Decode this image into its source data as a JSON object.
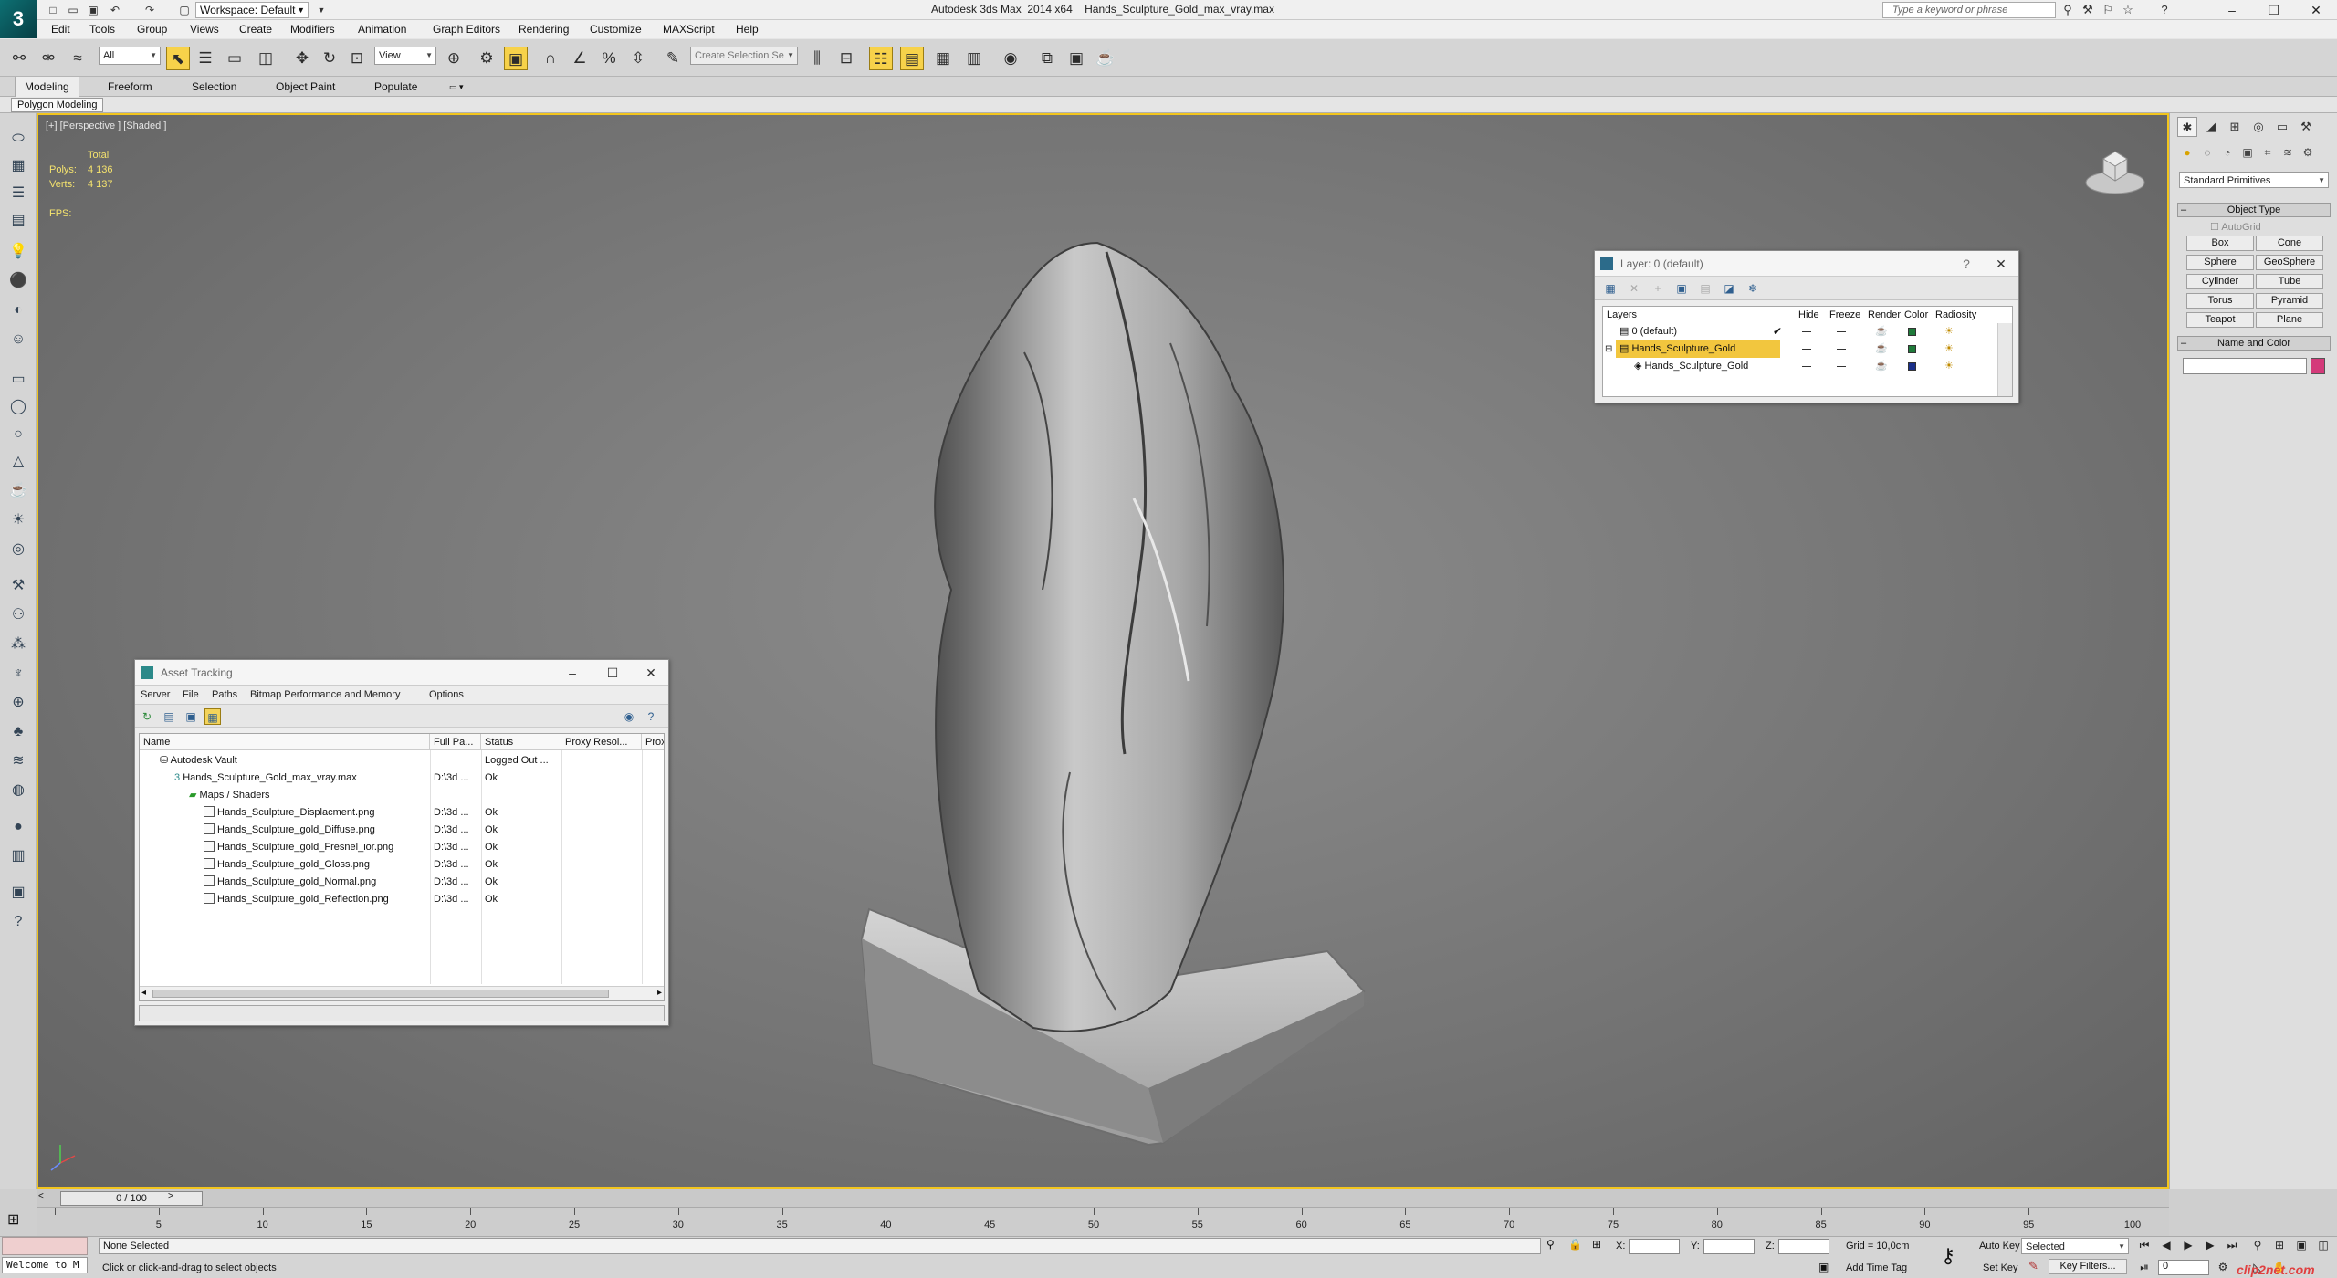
{
  "app": {
    "logo": "3",
    "title": "Autodesk 3ds Max  2014 x64    Hands_Sculpture_Gold_max_vray.max",
    "workspace": "Workspace: Default",
    "search_placeholder": "Type a keyword or phrase",
    "window_controls": [
      "–",
      "❐",
      "✕"
    ]
  },
  "menu": [
    "Edit",
    "Tools",
    "Group",
    "Views",
    "Create",
    "Modifiers",
    "Animation",
    "Graph Editors",
    "Rendering",
    "Customize",
    "MAXScript",
    "Help"
  ],
  "toolbar": {
    "filter": "All",
    "ref_coord": "View",
    "selection_set": "Create Selection Se"
  },
  "ribbon": {
    "tabs": [
      "Modeling",
      "Freeform",
      "Selection",
      "Object Paint",
      "Populate"
    ],
    "active": "Modeling",
    "panel_tab": "Polygon Modeling"
  },
  "viewport": {
    "label": "[+] [Perspective ] [Shaded ]",
    "stats": {
      "total_label": "Total",
      "polys_label": "Polys:",
      "polys": "4 136",
      "verts_label": "Verts:",
      "verts": "4 137",
      "fps_label": "FPS:"
    },
    "border_color": "#f2c51d"
  },
  "layer_dialog": {
    "title": "Layer: 0 (default)",
    "help": "?",
    "columns": [
      "Layers",
      "Hide",
      "Freeze",
      "Render",
      "Color",
      "Radiosity"
    ],
    "rows": [
      {
        "name": "0 (default)",
        "color": "#1f7a3a",
        "current": true,
        "selected": false
      },
      {
        "name": "Hands_Sculpture_Gold",
        "color": "#1f7a3a",
        "current": false,
        "selected": true
      },
      {
        "name": "Hands_Sculpture_Gold",
        "color": "#1a2f8a",
        "current": false,
        "selected": false
      }
    ]
  },
  "asset_dialog": {
    "title": "Asset Tracking",
    "menu": [
      "Server",
      "File",
      "Paths",
      "Bitmap Performance and Memory",
      "Options"
    ],
    "columns": [
      "Name",
      "Full Pa...",
      "Status",
      "Proxy Resol...",
      "Prox"
    ],
    "rows": [
      {
        "name": "Autodesk Vault",
        "path": "",
        "status": "Logged Out ...",
        "indent": 1
      },
      {
        "name": "Hands_Sculpture_Gold_max_vray.max",
        "path": "D:\\3d ...",
        "status": "Ok",
        "indent": 2
      },
      {
        "name": "Maps / Shaders",
        "path": "",
        "status": "",
        "indent": 3
      },
      {
        "name": "Hands_Sculpture_Displacment.png",
        "path": "D:\\3d ...",
        "status": "Ok",
        "indent": 4
      },
      {
        "name": "Hands_Sculpture_gold_Diffuse.png",
        "path": "D:\\3d ...",
        "status": "Ok",
        "indent": 4
      },
      {
        "name": "Hands_Sculpture_gold_Fresnel_ior.png",
        "path": "D:\\3d ...",
        "status": "Ok",
        "indent": 4
      },
      {
        "name": "Hands_Sculpture_gold_Gloss.png",
        "path": "D:\\3d ...",
        "status": "Ok",
        "indent": 4
      },
      {
        "name": "Hands_Sculpture_gold_Normal.png",
        "path": "D:\\3d ...",
        "status": "Ok",
        "indent": 4
      },
      {
        "name": "Hands_Sculpture_gold_Reflection.png",
        "path": "D:\\3d ...",
        "status": "Ok",
        "indent": 4
      }
    ]
  },
  "command_panel": {
    "category": "Standard Primitives",
    "object_type_label": "Object Type",
    "autogrid_label": "AutoGrid",
    "primitives": [
      "Box",
      "Cone",
      "Sphere",
      "GeoSphere",
      "Cylinder",
      "Tube",
      "Torus",
      "Pyramid",
      "Teapot",
      "Plane"
    ],
    "name_color_label": "Name and Color",
    "object_color": "#d43a7a"
  },
  "timeline": {
    "frame_label": "0 / 100",
    "ticks": [
      "5",
      "10",
      "15",
      "20",
      "25",
      "30",
      "35",
      "40",
      "45",
      "50",
      "55",
      "60",
      "65",
      "70",
      "75",
      "80",
      "85",
      "90",
      "95",
      "100"
    ]
  },
  "status": {
    "maxscript_listener": "Welcome to M",
    "selection": "None Selected",
    "prompt": "Click or click-and-drag to select objects",
    "x_label": "X:",
    "y_label": "Y:",
    "z_label": "Z:",
    "grid": "Grid = 10,0cm",
    "add_time_tag": "Add Time Tag",
    "auto_key": "Auto Key",
    "set_key": "Set Key",
    "key_mode": "Selected",
    "key_filters": "Key Filters...",
    "current_frame": "0",
    "watermark": "clip2net.com"
  }
}
